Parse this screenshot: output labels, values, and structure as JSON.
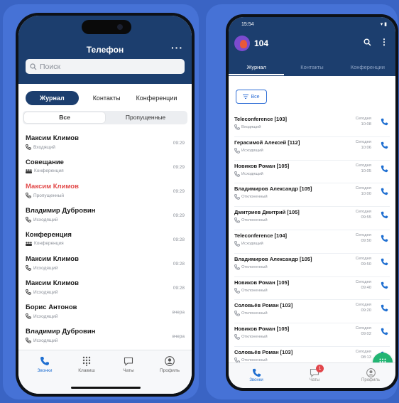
{
  "left": {
    "title": "Телефон",
    "more": "···",
    "search_placeholder": "Поиск",
    "tabs": [
      "Журнал",
      "Контакты",
      "Конференции"
    ],
    "filters": [
      "Все",
      "Пропущенные"
    ],
    "calls": [
      {
        "name": "Максим Климов",
        "type": "Входящий",
        "time": "09:29",
        "missed": false,
        "icon": "phone-incoming-icon"
      },
      {
        "name": "Совещание",
        "type": "Конференция",
        "time": "09:29",
        "missed": false,
        "icon": "group-icon"
      },
      {
        "name": "Максим Климов",
        "type": "Пропущенный",
        "time": "09:29",
        "missed": true,
        "icon": "phone-missed-icon"
      },
      {
        "name": "Владимир Дубровин",
        "type": "Исходящий",
        "time": "09:29",
        "missed": false,
        "icon": "phone-outgoing-icon"
      },
      {
        "name": "Конференция",
        "type": "Конференция",
        "time": "09:28",
        "missed": false,
        "icon": "group-icon"
      },
      {
        "name": "Максим Климов",
        "type": "Исходящий",
        "time": "09:28",
        "missed": false,
        "icon": "phone-outgoing-icon"
      },
      {
        "name": "Максим Климов",
        "type": "Исходящий",
        "time": "09:28",
        "missed": false,
        "icon": "phone-outgoing-icon"
      },
      {
        "name": "Борис Антонов",
        "type": "Исходящий",
        "time": "вчера",
        "missed": false,
        "icon": "phone-outgoing-icon"
      },
      {
        "name": "Владимир Дубровин",
        "type": "Исходящий",
        "time": "вчера",
        "missed": false,
        "icon": "phone-outgoing-icon"
      },
      {
        "name": "Максим Климов",
        "type": "",
        "time": "",
        "missed": true,
        "icon": ""
      }
    ],
    "tabbar": [
      "Звонки",
      "Клавиш",
      "Чаты",
      "Профиль"
    ]
  },
  "right": {
    "clock": "15:54",
    "status_icons": "▾ ▮",
    "user": "104",
    "tabs": [
      "Журнал",
      "Контакты",
      "Конференции"
    ],
    "filter_label": "Все",
    "calls": [
      {
        "name": "Teleconference [103]",
        "type": "Входящий",
        "day": "Сегодня",
        "time": "10:08"
      },
      {
        "name": "Герасимой Алексей [112]",
        "type": "Исходящий",
        "day": "Сегодня",
        "time": "10:06"
      },
      {
        "name": "Новиков Роман [105]",
        "type": "Исходящий",
        "day": "Сегодня",
        "time": "10:05"
      },
      {
        "name": "Владимиров Александр [105]",
        "type": "Отклоненный",
        "day": "Сегодня",
        "time": "10:00"
      },
      {
        "name": "Дмитриев Дмитрий [105]",
        "type": "Отклоненный",
        "day": "Сегодня",
        "time": "09:55"
      },
      {
        "name": "Teleconference [104]",
        "type": "Исходящий",
        "day": "Сегодня",
        "time": "09:50"
      },
      {
        "name": "Владимиров Александр [105]",
        "type": "Отклоненный",
        "day": "Сегодня",
        "time": "09:50"
      },
      {
        "name": "Новиков Роман [105]",
        "type": "Отклоненный",
        "day": "Сегодня",
        "time": "09:40"
      },
      {
        "name": "Соловьёв Роман [103]",
        "type": "Отклоненный",
        "day": "Сегодня",
        "time": "09:20"
      },
      {
        "name": "Новиков Роман [105]",
        "type": "Отклоненный",
        "day": "Сегодня",
        "time": "09:02"
      },
      {
        "name": "Соловьёв Роман [103]",
        "type": "Отклоненный",
        "day": "Сегодня",
        "time": "08:13"
      }
    ],
    "tabbar": [
      "Звонки",
      "Чаты",
      "Профиль"
    ],
    "chat_badge": "1"
  }
}
